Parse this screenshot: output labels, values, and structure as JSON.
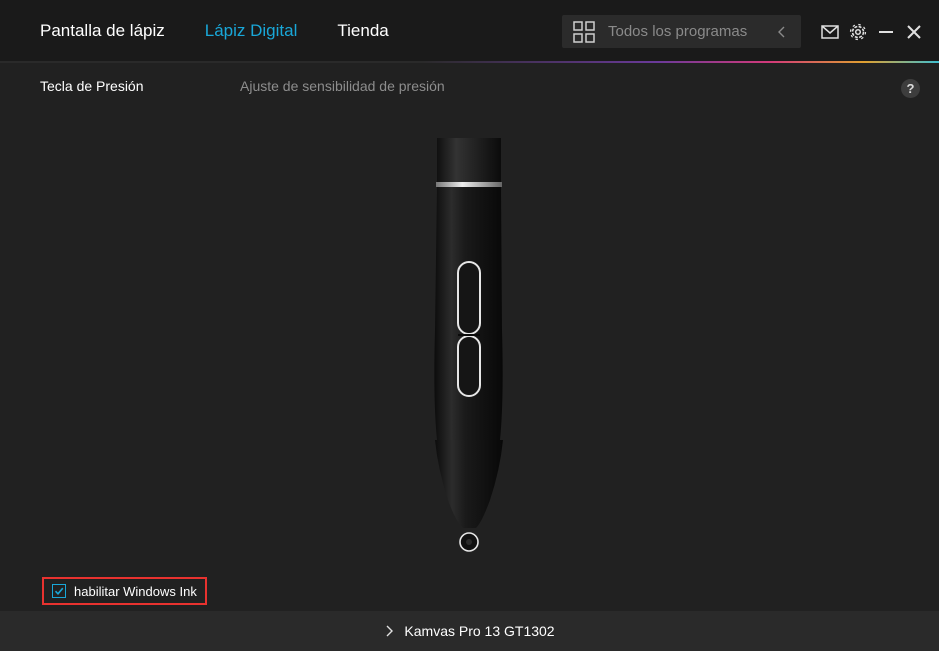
{
  "nav": {
    "tabs": [
      {
        "label": "Pantalla de lápiz"
      },
      {
        "label": "Lápiz Digital"
      },
      {
        "label": "Tienda"
      }
    ],
    "active_index": 1
  },
  "programs": {
    "label": "Todos los programas"
  },
  "subtabs": {
    "pressure_key": "Tecla de Presión",
    "sensitivity": "Ajuste de sensibilidad de presión"
  },
  "help": {
    "label": "?"
  },
  "windows_ink": {
    "label": "habilitar Windows Ink",
    "checked": true
  },
  "footer": {
    "device": "Kamvas Pro 13 GT1302"
  },
  "colors": {
    "accent": "#19a7d8",
    "highlight_border": "#e8322f",
    "background": "#212121"
  },
  "icons": [
    "grid-icon",
    "chevron-left-icon",
    "mail-icon",
    "gear-icon",
    "minimize-icon",
    "close-icon",
    "chevron-right-icon",
    "checkmark-icon",
    "help-icon"
  ]
}
